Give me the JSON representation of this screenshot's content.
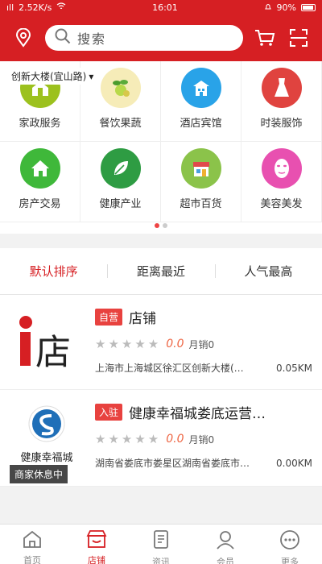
{
  "status_bar": {
    "signal": "ıll",
    "speed": "2.52K/s",
    "time": "16:01",
    "battery": "90%"
  },
  "header": {
    "search_placeholder": "搜索",
    "location": "创新大楼(宜山路)"
  },
  "categories": [
    {
      "label": "家政服务",
      "icon": "home-service-icon",
      "color": "#9cc11e"
    },
    {
      "label": "餐饮果蔬",
      "icon": "vegetable-icon",
      "color": "#f6ecb8"
    },
    {
      "label": "酒店宾馆",
      "icon": "hotel-icon",
      "color": "#29a3e8"
    },
    {
      "label": "时装服饰",
      "icon": "dress-icon",
      "color": "#e0433f"
    },
    {
      "label": "房产交易",
      "icon": "house-icon",
      "color": "#3fb83a"
    },
    {
      "label": "健康产业",
      "icon": "leaf-icon",
      "color": "#2e9c43"
    },
    {
      "label": "超市百货",
      "icon": "store-icon",
      "color": "#8bc34a"
    },
    {
      "label": "美容美发",
      "icon": "face-mask-icon",
      "color": "#e850b0"
    }
  ],
  "sort_tabs": [
    "默认排序",
    "距离最近",
    "人气最高"
  ],
  "shops": [
    {
      "badge": "自营",
      "name": "店铺",
      "stars": "★★★★★",
      "score": "0.0",
      "sales": "月销0",
      "address": "上海市上海城区徐汇区创新大楼(…",
      "distance": "0.05KM",
      "logo_char": "店"
    },
    {
      "badge": "入驻",
      "name": "健康幸福城娄底运营…",
      "stars": "★★★★★",
      "score": "0.0",
      "sales": "月销0",
      "address": "湖南省娄底市娄星区湖南省娄底市…",
      "distance": "0.00KM",
      "logo_text": "健康幸福城",
      "resting": "商家休息中"
    }
  ],
  "bottom_nav": [
    {
      "label": "首页",
      "icon": "home-icon"
    },
    {
      "label": "店铺",
      "icon": "shop-icon"
    },
    {
      "label": "资讯",
      "icon": "news-icon"
    },
    {
      "label": "会员",
      "icon": "user-icon"
    },
    {
      "label": "更多",
      "icon": "more-icon"
    }
  ],
  "colors": {
    "brand": "#d61f23",
    "accent": "#e8423f"
  }
}
